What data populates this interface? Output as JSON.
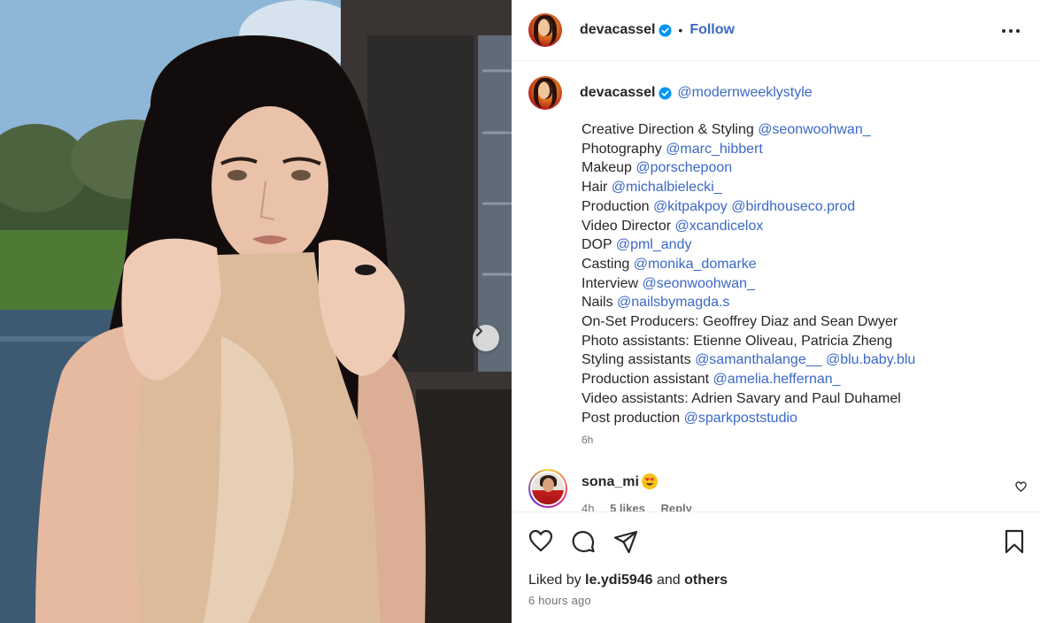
{
  "post": {
    "author": "devacassel",
    "follow_label": "Follow",
    "dot": "•"
  },
  "caption": {
    "author": "devacassel",
    "tag": "@modernweeklystyle",
    "lines": [
      {
        "text": "Creative Direction & Styling ",
        "mentions": [
          "@seonwoohwan_"
        ]
      },
      {
        "text": "Photography ",
        "mentions": [
          "@marc_hibbert"
        ]
      },
      {
        "text": "Makeup ",
        "mentions": [
          "@porschepoon"
        ]
      },
      {
        "text": "Hair ",
        "mentions": [
          "@michalbielecki_"
        ]
      },
      {
        "text": "Production ",
        "mentions": [
          "@kitpakpoy",
          "@birdhouseco.prod"
        ]
      },
      {
        "text": "Video Director ",
        "mentions": [
          "@xcandicelox"
        ]
      },
      {
        "text": "DOP ",
        "mentions": [
          "@pml_andy"
        ]
      },
      {
        "text": "Casting ",
        "mentions": [
          "@monika_domarke"
        ]
      },
      {
        "text": "Interview ",
        "mentions": [
          "@seonwoohwan_"
        ]
      },
      {
        "text": "Nails ",
        "mentions": [
          "@nailsbymagda.s"
        ]
      },
      {
        "text": "On-Set Producers: Geoffrey Diaz and Sean Dwyer",
        "mentions": []
      },
      {
        "text": "Photo assistants: Etienne Oliveau, Patricia Zheng",
        "mentions": []
      },
      {
        "text": "Styling assistants ",
        "mentions": [
          "@samanthalange__",
          "@blu.baby.blu"
        ]
      },
      {
        "text": "Production assistant ",
        "mentions": [
          "@amelia.heffernan_"
        ]
      },
      {
        "text": "Video assistants: Adrien Savary and Paul Duhamel",
        "mentions": []
      },
      {
        "text": "Post production ",
        "mentions": [
          "@sparkpoststudio"
        ]
      }
    ],
    "time": "6h"
  },
  "comment": {
    "user": "sona_mi",
    "time": "4h",
    "likes": "5 likes",
    "reply_label": "Reply"
  },
  "footer": {
    "liked_prefix": "Liked by ",
    "liked_user": "le.ydi5946",
    "liked_and": " and ",
    "liked_others": "others",
    "ago": "6 hours ago"
  },
  "icons": {
    "verified": "verified-badge-icon",
    "more": "more-options-icon",
    "next": "chevron-right-icon",
    "heart": "heart-icon",
    "comment": "comment-icon",
    "share": "share-icon",
    "save": "bookmark-icon"
  },
  "colors": {
    "link": "#3b68c6",
    "verified": "#0095f6",
    "muted": "#737373",
    "text": "#262626"
  }
}
